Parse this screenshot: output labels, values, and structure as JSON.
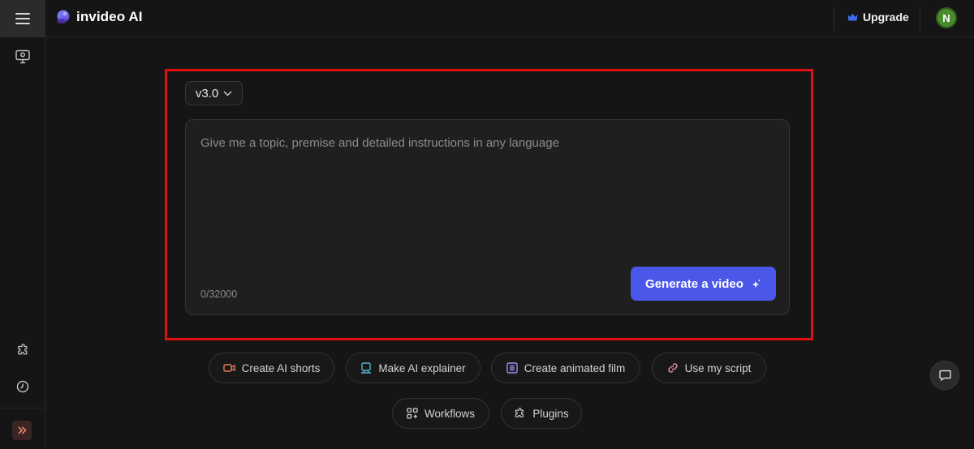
{
  "header": {
    "logo_text": "invideo AI",
    "upgrade_label": "Upgrade",
    "avatar_initial": "N"
  },
  "rail": {
    "icons": [
      "menu-icon",
      "lightbulb-monitor-icon",
      "puzzle-icon",
      "history-icon",
      "double-chevron-right-icon"
    ]
  },
  "composer": {
    "version_label": "v3.0",
    "prompt_placeholder": "Give me a topic, premise and detailed instructions in any language",
    "char_counter": "0/32000",
    "generate_label": "Generate a video"
  },
  "quick_actions": [
    {
      "label": "Create AI shorts",
      "icon": "video-camera-icon",
      "color": "#e0805a"
    },
    {
      "label": "Make AI explainer",
      "icon": "presentation-icon",
      "color": "#4fb3c9"
    },
    {
      "label": "Create animated film",
      "icon": "film-list-icon",
      "color": "#9d8cf0"
    },
    {
      "label": "Use my script",
      "icon": "link-icon",
      "color": "#e58bb0"
    },
    {
      "label": "Workflows",
      "icon": "grid-plus-icon",
      "color": "#cfcfcf"
    },
    {
      "label": "Plugins",
      "icon": "puzzle-icon",
      "color": "#cfcfcf"
    }
  ],
  "colors": {
    "background": "#151515",
    "accent": "#4a57e8",
    "highlight_border": "#e01010",
    "avatar": "#4a8b2f",
    "upgrade_crown": "#3b6cf0"
  }
}
